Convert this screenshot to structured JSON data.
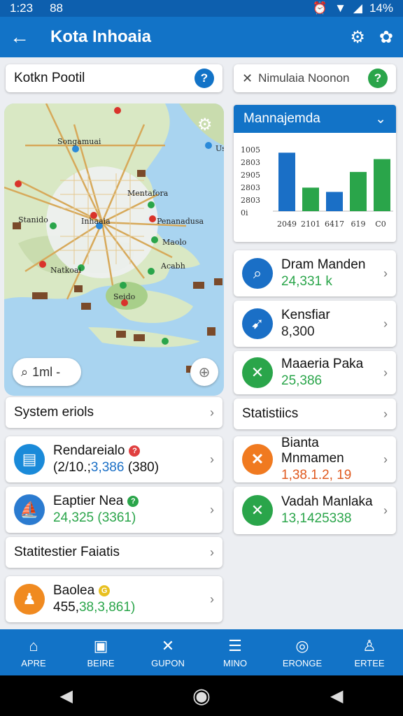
{
  "status": {
    "time": "1:23",
    "extra": "88",
    "battery": "14%"
  },
  "appbar": {
    "back_icon": "arrow-left-icon",
    "title": "Kota Inhoaia"
  },
  "search": {
    "text": "Kotkn Pootil",
    "help": "?"
  },
  "search2": {
    "text": "Nimulaia Noonon",
    "help": "?"
  },
  "map": {
    "labels": [
      "Songamuai",
      "Mentafora",
      "Stanido",
      "Inhaaia",
      "Penanadusa",
      "Maolo",
      "Natkoai",
      "Acabh",
      "Seido",
      "Us"
    ],
    "search_text": "1ml -"
  },
  "chart": {
    "title": "Mannajemda",
    "accent": "#1273c7"
  },
  "chart_data": {
    "type": "bar",
    "title": "Mannajemda",
    "y_tick_labels": [
      "1005",
      "2803",
      "2905",
      "2803",
      "2803",
      "0i"
    ],
    "categories": [
      "2049",
      "2101",
      "6417",
      "619",
      "C0"
    ],
    "series": [
      {
        "values": [
          82,
          0,
          0,
          0,
          0
        ]
      },
      {
        "values": [
          0,
          33,
          0,
          55,
          73
        ]
      },
      {
        "values": [
          0,
          0,
          27,
          0,
          0
        ]
      }
    ],
    "series_colors": [
      "#1a6fc6",
      "#2aa54a",
      "#1a6fc6"
    ],
    "ylim": [
      0,
      100
    ]
  },
  "left_rows": {
    "system": "System eriols",
    "stat": "Statitestier Faiatis"
  },
  "left_items": [
    {
      "title": "Rendareialo",
      "value_a": "(2/10.;",
      "value_b": "3,386",
      "value_c": "(380)",
      "badge": "?",
      "badge_color": "#e04040"
    },
    {
      "title": "Eaptier Nea",
      "value": "24,325 (3361)",
      "badge": "?",
      "badge_color": "#2aa54a"
    },
    {
      "title": "Baolea",
      "value_a": "455,",
      "value_b": "38,3,861)",
      "badge": "G",
      "badge_color": "#e8c020"
    }
  ],
  "right_items": [
    {
      "title": "Dram Manden",
      "value": "24,331 k",
      "value_color": "#2aa54a"
    },
    {
      "title": "Kensfiar",
      "value": "8,300",
      "value_color": "#222"
    },
    {
      "title": "Maaeria Paka",
      "value": "25,386",
      "value_color": "#2aa54a"
    }
  ],
  "right_stat": "Statistiics",
  "right_items2": [
    {
      "title": "Bianta Mnmamen",
      "value": "1,38.1.2, 19",
      "value_color": "#e05a20"
    },
    {
      "title": "Vadah Manlaka",
      "value": "13,1425338",
      "value_color": "#2aa54a"
    }
  ],
  "nav": [
    {
      "label": "APRE",
      "icon": "home-icon"
    },
    {
      "label": "BEIRE",
      "icon": "device-icon"
    },
    {
      "label": "GUPON",
      "icon": "tools-icon"
    },
    {
      "label": "MINO",
      "icon": "list-icon"
    },
    {
      "label": "ERONGE",
      "icon": "compass-icon"
    },
    {
      "label": "ERTEE",
      "icon": "person-icon"
    }
  ]
}
